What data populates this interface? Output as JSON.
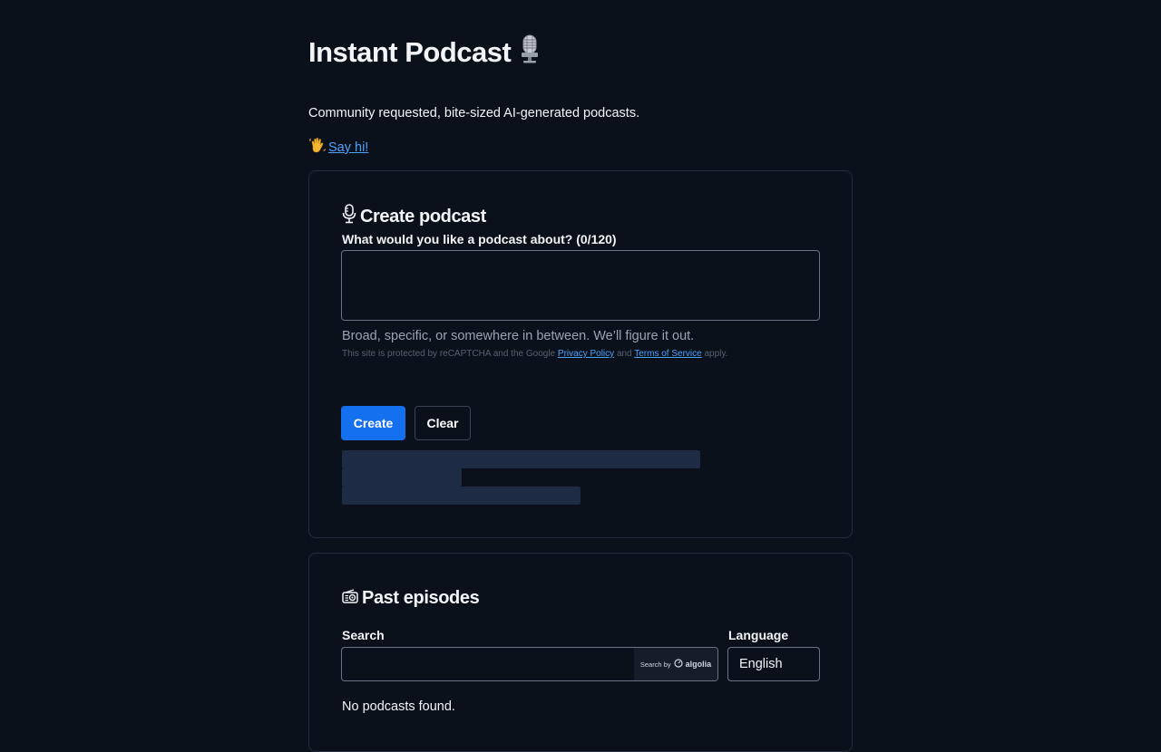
{
  "header": {
    "title": "Instant Podcast",
    "title_icon": "studio-microphone-icon",
    "tagline": "Community requested, bite-sized AI-generated podcasts.",
    "say_hi_icon": "waving-hand-icon",
    "say_hi_label": "Say hi!"
  },
  "create": {
    "heading": "Create podcast",
    "heading_icon": "microphone-icon",
    "prompt_label": "What would you like a podcast about? (0/120)",
    "prompt_value": "",
    "hint": "Broad, specific, or somewhere in between. We’ll figure it out.",
    "recaptcha_prefix": "This site is protected by reCAPTCHA and the Google",
    "privacy_label": "Privacy Policy",
    "and_text": "and",
    "terms_label": "Terms of Service",
    "apply_text": "apply.",
    "create_button": "Create",
    "clear_button": "Clear"
  },
  "past": {
    "heading": "Past episodes",
    "heading_icon": "radio-icon",
    "search_label": "Search",
    "search_value": "",
    "search_by": "Search by",
    "algolia_brand": "algolia",
    "language_label": "Language",
    "language_value": "English",
    "empty_message": "No podcasts found."
  },
  "colors": {
    "background": "#0b111b",
    "accent": "#1570ef",
    "link": "#4aa3ff",
    "skeleton": "#1d2b45"
  }
}
